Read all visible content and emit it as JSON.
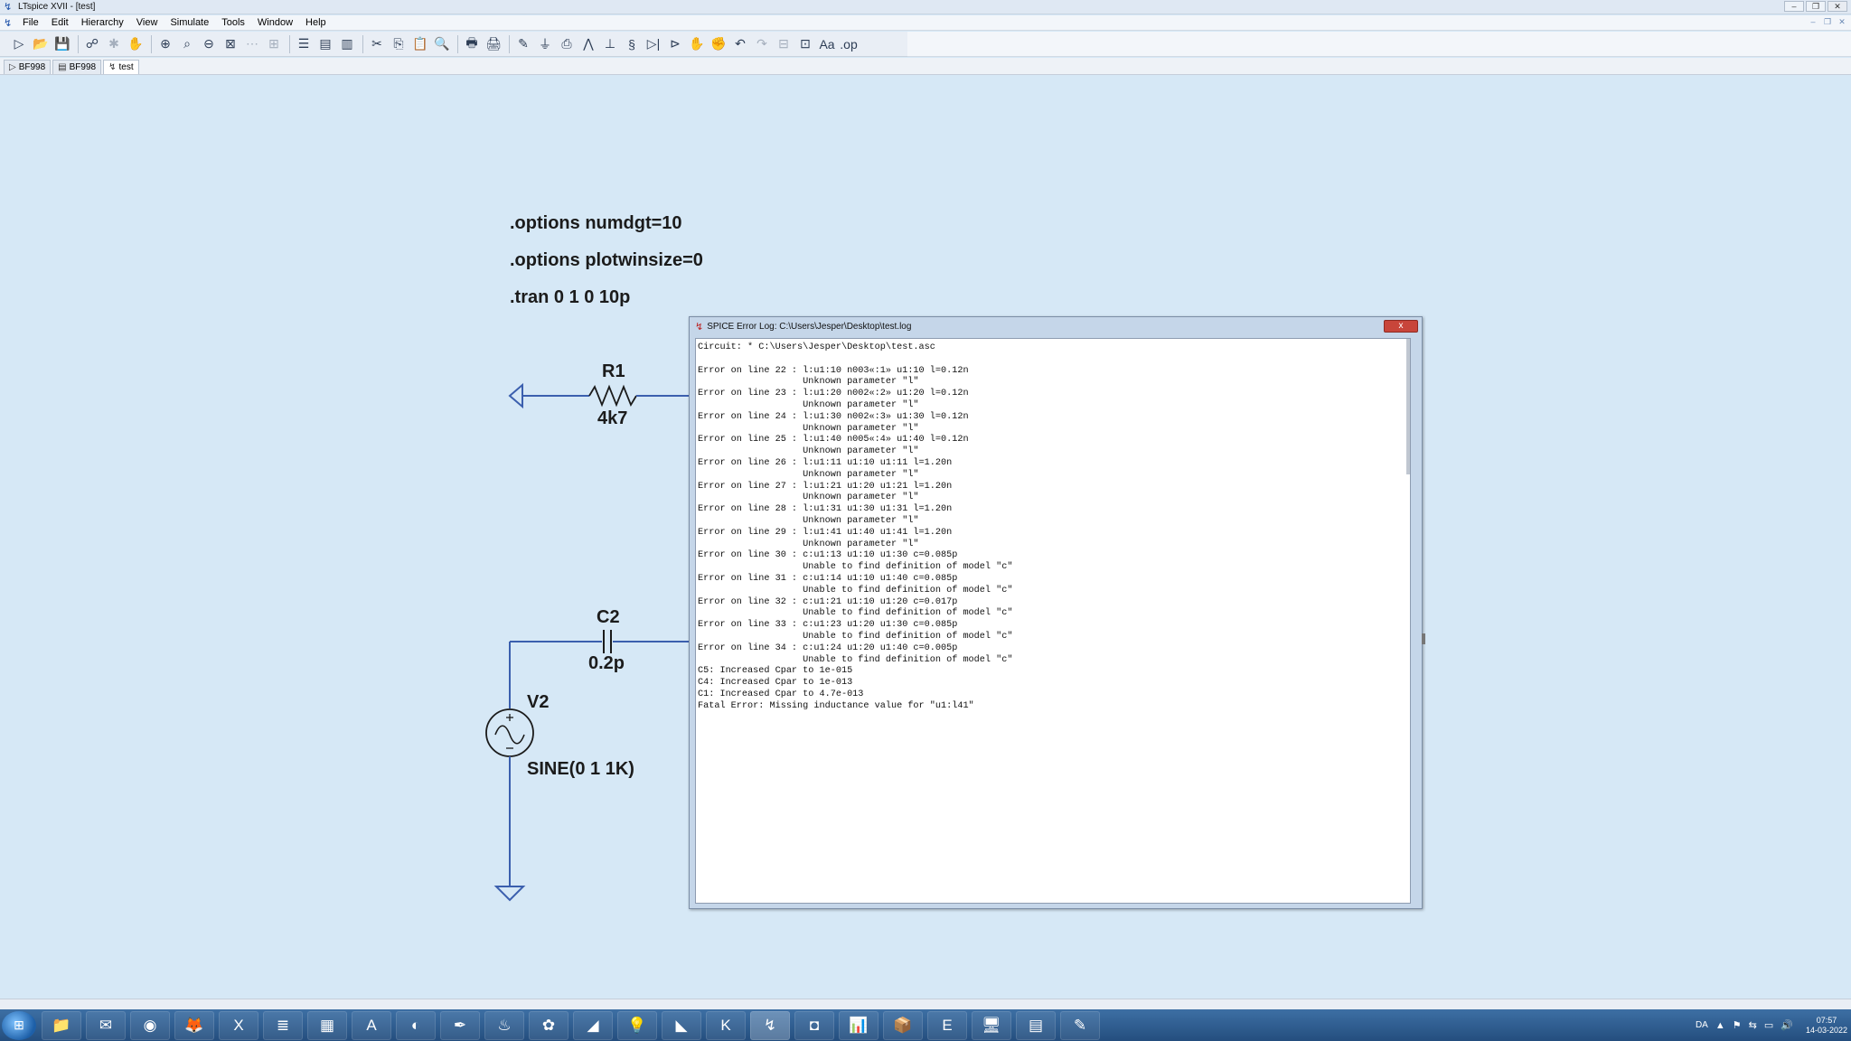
{
  "window": {
    "title": "LTspice XVII - [test]",
    "controls": [
      "–",
      "❐",
      "✕"
    ]
  },
  "menu": {
    "items": [
      {
        "label": "File",
        "key": "F"
      },
      {
        "label": "Edit",
        "key": "E"
      },
      {
        "label": "Hierarchy",
        "key": "H"
      },
      {
        "label": "View",
        "key": "V"
      },
      {
        "label": "Simulate",
        "key": "S"
      },
      {
        "label": "Tools",
        "key": "T"
      },
      {
        "label": "Window",
        "key": "W"
      },
      {
        "label": "Help",
        "key": "H"
      }
    ],
    "mdi_controls": [
      "–",
      "❐",
      "✕"
    ]
  },
  "toolbar": {
    "icons": [
      "new-schematic-icon",
      "open-icon",
      "save-icon",
      "control-panel-icon",
      "run-icon",
      "halt-icon",
      "zoom-in-icon",
      "zoom-area-icon",
      "zoom-out-icon",
      "zoom-fit-icon",
      "autoscale-icon",
      "tile-icon",
      "tile-horizontal-icon",
      "tile-vertical-icon",
      "cascade-icon",
      "cut-icon",
      "copy-icon",
      "paste-icon",
      "find-icon",
      "print-icon",
      "print-setup-icon",
      "wire-icon",
      "ground-icon",
      "label-net-icon",
      "resistor-icon",
      "capacitor-icon",
      "inductor-icon",
      "diode-icon",
      "component-icon",
      "move-icon",
      "drag-icon",
      "undo-icon",
      "redo-icon",
      "rotate-icon",
      "mirror-icon",
      "text-icon",
      "spice-directive-icon"
    ],
    "glyphs": [
      "▷",
      "📂",
      "💾",
      "☍",
      "✱",
      "✋",
      "⊕",
      "⌕",
      "⊖",
      "⊠",
      "⋯",
      "⊞",
      "☰",
      "▤",
      "▥",
      "✂",
      "⎘",
      "📋",
      "🔍",
      "🖶",
      "🖨",
      "✎",
      "⏚",
      "⎙",
      "⋀",
      "⊥",
      "§",
      "▷|",
      "⊳",
      "✋",
      "✊",
      "↶",
      "↷",
      "⊟",
      "⊡",
      "Aa",
      ".op"
    ]
  },
  "tabs": [
    {
      "label": "BF998",
      "icon": "▷"
    },
    {
      "label": "BF998",
      "icon": "▤"
    },
    {
      "label": "test",
      "icon": "↯"
    }
  ],
  "schematic": {
    "directives": [
      ".options numdgt=10",
      ".options plotwinsize=0",
      ".tran 0 1 0 10p"
    ],
    "r1": {
      "name": "R1",
      "value": "4k7"
    },
    "c2": {
      "name": "C2",
      "value": "0.2p"
    },
    "v2": {
      "name": "V2",
      "value": "SINE(0 1 1K)"
    },
    "wire_color": "#3b5fae",
    "component_color": "#1b1b1b"
  },
  "error_log": {
    "title": "SPICE Error Log: C:\\Users\\Jesper\\Desktop\\test.log",
    "close_label": "x",
    "lines": [
      "Circuit: * C:\\Users\\Jesper\\Desktop\\test.asc",
      "",
      "Error on line 22 : l:u1:10 n003«:1» u1:10 l=0.12n",
      "                   Unknown parameter \"l\"",
      "Error on line 23 : l:u1:20 n002«:2» u1:20 l=0.12n",
      "                   Unknown parameter \"l\"",
      "Error on line 24 : l:u1:30 n002«:3» u1:30 l=0.12n",
      "                   Unknown parameter \"l\"",
      "Error on line 25 : l:u1:40 n005«:4» u1:40 l=0.12n",
      "                   Unknown parameter \"l\"",
      "Error on line 26 : l:u1:11 u1:10 u1:11 l=1.20n",
      "                   Unknown parameter \"l\"",
      "Error on line 27 : l:u1:21 u1:20 u1:21 l=1.20n",
      "                   Unknown parameter \"l\"",
      "Error on line 28 : l:u1:31 u1:30 u1:31 l=1.20n",
      "                   Unknown parameter \"l\"",
      "Error on line 29 : l:u1:41 u1:40 u1:41 l=1.20n",
      "                   Unknown parameter \"l\"",
      "Error on line 30 : c:u1:13 u1:10 u1:30 c=0.085p",
      "                   Unable to find definition of model \"c\"",
      "Error on line 31 : c:u1:14 u1:10 u1:40 c=0.085p",
      "                   Unable to find definition of model \"c\"",
      "Error on line 32 : c:u1:21 u1:10 u1:20 c=0.017p",
      "                   Unable to find definition of model \"c\"",
      "Error on line 33 : c:u1:23 u1:20 u1:30 c=0.085p",
      "                   Unable to find definition of model \"c\"",
      "Error on line 34 : c:u1:24 u1:20 u1:40 c=0.005p",
      "                   Unable to find definition of model \"c\"",
      "C5: Increased Cpar to 1e-015",
      "C4: Increased Cpar to 1e-013",
      "C1: Increased Cpar to 4.7e-013",
      "Fatal Error: Missing inductance value for \"u1:l41\""
    ]
  },
  "taskbar": {
    "apps": [
      {
        "name": "explorer",
        "glyph": "📁"
      },
      {
        "name": "outlook",
        "glyph": "✉"
      },
      {
        "name": "chrome",
        "glyph": "◉"
      },
      {
        "name": "firefox",
        "glyph": "🦊"
      },
      {
        "name": "excel",
        "glyph": "X"
      },
      {
        "name": "word-doc",
        "glyph": "≣"
      },
      {
        "name": "spreadsheet",
        "glyph": "▦"
      },
      {
        "name": "acrobat",
        "glyph": "A"
      },
      {
        "name": "app-circle",
        "glyph": "◐"
      },
      {
        "name": "app-pen",
        "glyph": "✒"
      },
      {
        "name": "app-orange",
        "glyph": "♨"
      },
      {
        "name": "app-pink",
        "glyph": "✿"
      },
      {
        "name": "app-red",
        "glyph": "◢"
      },
      {
        "name": "app-bulb",
        "glyph": "💡"
      },
      {
        "name": "app-green",
        "glyph": "◣"
      },
      {
        "name": "app-k",
        "glyph": "K"
      },
      {
        "name": "ltspice",
        "glyph": "↯",
        "active": true
      },
      {
        "name": "app-blue",
        "glyph": "◘"
      },
      {
        "name": "app-chart",
        "glyph": "📊"
      },
      {
        "name": "app-box",
        "glyph": "📦"
      },
      {
        "name": "app-e",
        "glyph": "E"
      },
      {
        "name": "app-monitor",
        "glyph": "🖥"
      },
      {
        "name": "app-doc",
        "glyph": "▤"
      },
      {
        "name": "app-edit",
        "glyph": "✎"
      }
    ],
    "language": "DA",
    "tray_icons": [
      "▲",
      "⚑",
      "⇆",
      "▭",
      "🔊"
    ],
    "time": "07:57",
    "date": "14-03-2022"
  }
}
